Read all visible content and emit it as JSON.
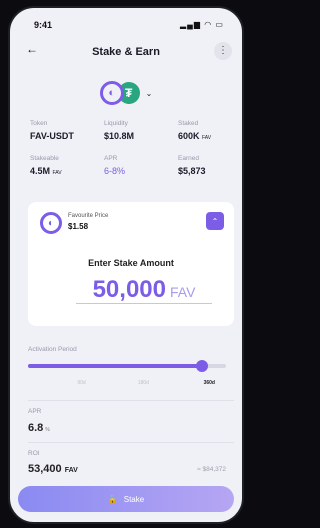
{
  "status": {
    "time": "9:41",
    "icons": "▂▄▆ ◠ ▭"
  },
  "nav": {
    "back_icon": "←",
    "title": "Stake & Earn",
    "more_icon": "⋮"
  },
  "token_pair": {
    "coin1_glyph": "◐",
    "coin2_glyph": "₮",
    "chevron": "⌄"
  },
  "stats": [
    {
      "label": "Token",
      "value": "FAV-USDT",
      "unit": ""
    },
    {
      "label": "Liquidity",
      "value": "$10.8M",
      "unit": ""
    },
    {
      "label": "Staked",
      "value": "600K",
      "unit": "FAV"
    },
    {
      "label": "Stakeable",
      "value": "4.5M",
      "unit": "FAV"
    },
    {
      "label": "APR",
      "value": "6-8%",
      "unit": ""
    },
    {
      "label": "Earned",
      "value": "$5,873",
      "unit": ""
    }
  ],
  "price": {
    "label": "Favourite Price",
    "value": "$1.58",
    "icon": "◐",
    "collapse_icon": "⌃"
  },
  "stake": {
    "heading": "Enter Stake Amount",
    "amount": "50,000",
    "unit": "FAV"
  },
  "activation": {
    "label": "Activation Period",
    "ticks": [
      "90d",
      "180d",
      "360d"
    ],
    "selected_index": 2,
    "slider_fraction": 0.88
  },
  "apr": {
    "label": "APR",
    "value": "6.8",
    "unit": "%"
  },
  "roi": {
    "label": "ROI",
    "value": "53,400",
    "unit": "FAV",
    "usd": "≈ $84,372"
  },
  "button": {
    "icon": "🔒",
    "label": "Stake"
  },
  "colors": {
    "accent": "#7b5de6",
    "usdt": "#29a57f"
  }
}
